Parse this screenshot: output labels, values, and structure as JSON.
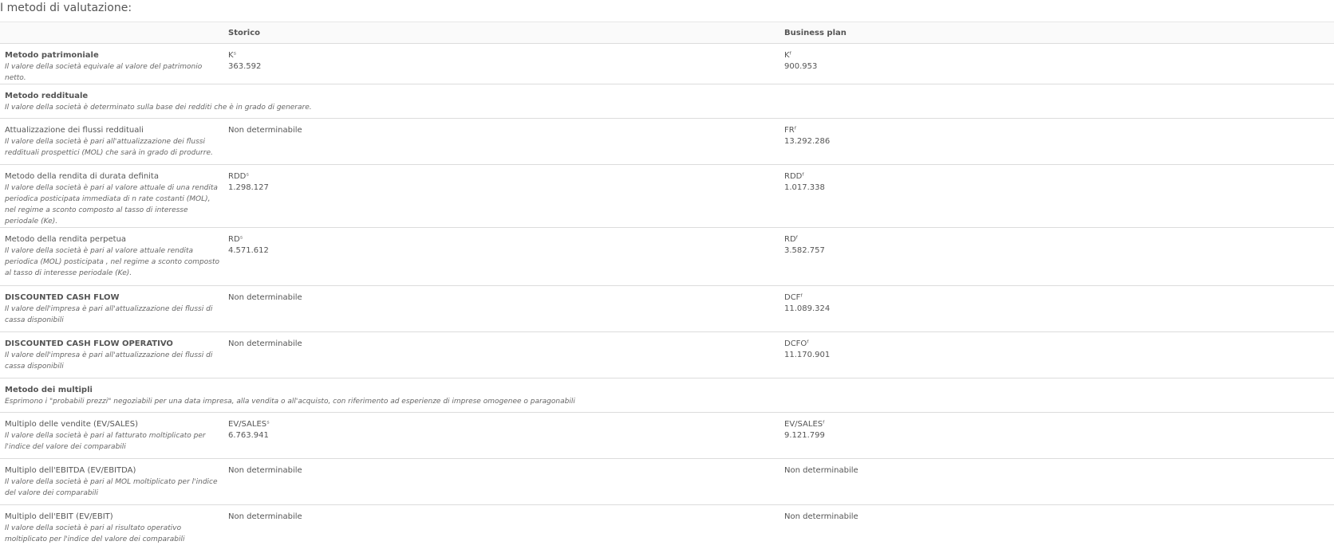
{
  "title": "I metodi di valutazione:",
  "columns": {
    "storico": "Storico",
    "business_plan": "Business plan"
  },
  "rows": [
    {
      "name": "Metodo patrimoniale",
      "bold": true,
      "desc": "Il valore della società equivale al valore del patrimonio netto.",
      "storico": {
        "sym": "Kˢ",
        "val": "363.592"
      },
      "bp": {
        "sym": "Kᶠ",
        "val": "900.953"
      }
    },
    {
      "name": "Metodo reddituale",
      "bold": true,
      "section": true,
      "desc": "Il valore della società è determinato sulla base dei redditi che è in grado di generare."
    },
    {
      "name": "Attualizzazione dei flussi reddituali",
      "bold": false,
      "desc": "Il valore della società è pari all'attualizzazione dei flussi reddituali prospettici (MOL) che sarà in grado di produrre.",
      "storico": {
        "text": "Non determinabile"
      },
      "bp": {
        "sym": "FRᶠ",
        "val": "13.292.286"
      }
    },
    {
      "name": "Metodo della rendita di durata definita",
      "bold": false,
      "desc": "Il valore della società è pari al valore attuale di una rendita periodica posticipata immediata di n rate costanti (MOL), nel regime a sconto composto al tasso di interesse periodale (Ke).",
      "storico": {
        "sym": "RDDˢ",
        "val": "1.298.127"
      },
      "bp": {
        "sym": "RDDᶠ",
        "val": "1.017.338"
      }
    },
    {
      "name": "Metodo della rendita perpetua",
      "bold": false,
      "desc": "Il valore della società è pari al valore attuale rendita periodica (MOL) posticipata , nel regime a sconto composto al tasso di interesse periodale (Ke).",
      "storico": {
        "sym": "RDˢ",
        "val": "4.571.612"
      },
      "bp": {
        "sym": "RDᶠ",
        "val": "3.582.757"
      }
    },
    {
      "name": "DISCOUNTED CASH FLOW",
      "bold": true,
      "desc": "Il valore dell'impresa è pari all'attualizzazione dei flussi di cassa disponibili",
      "storico": {
        "text": "Non determinabile"
      },
      "bp": {
        "sym": "DCFᶠ",
        "val": "11.089.324"
      }
    },
    {
      "name": "DISCOUNTED CASH FLOW OPERATIVO",
      "bold": true,
      "desc": "Il valore dell'impresa è pari all'attualizzazione dei flussi di cassa disponibili",
      "storico": {
        "text": "Non determinabile"
      },
      "bp": {
        "sym": "DCFOᶠ",
        "val": "11.170.901"
      }
    },
    {
      "name": "Metodo dei multipli",
      "bold": true,
      "section": true,
      "desc": "Esprimono i \"probabili prezzi\" negoziabili per una data impresa, alla vendita o all'acquisto, con riferimento ad esperienze di imprese omogenee o paragonabili"
    },
    {
      "name": "Multiplo delle vendite (EV/SALES)",
      "bold": false,
      "desc": "Il valore della società è pari al fatturato moltiplicato per l'indice del valore dei comparabili",
      "storico": {
        "sym": "EV/SALESˢ",
        "val": "6.763.941"
      },
      "bp": {
        "sym": "EV/SALESᶠ",
        "val": "9.121.799"
      }
    },
    {
      "name": "Multiplo dell'EBITDA (EV/EBITDA)",
      "bold": false,
      "desc": "Il valore della società è pari al MOL moltiplicato per l'indice del valore dei comparabili",
      "storico": {
        "text": "Non determinabile"
      },
      "bp": {
        "text": "Non determinabile"
      }
    },
    {
      "name": "Multiplo dell'EBIT (EV/EBIT)",
      "bold": false,
      "desc": "Il valore della società è pari al risultato operativo moltiplicato per l'indice del valore dei comparabili",
      "storico": {
        "text": "Non determinabile"
      },
      "bp": {
        "text": "Non determinabile"
      }
    }
  ]
}
